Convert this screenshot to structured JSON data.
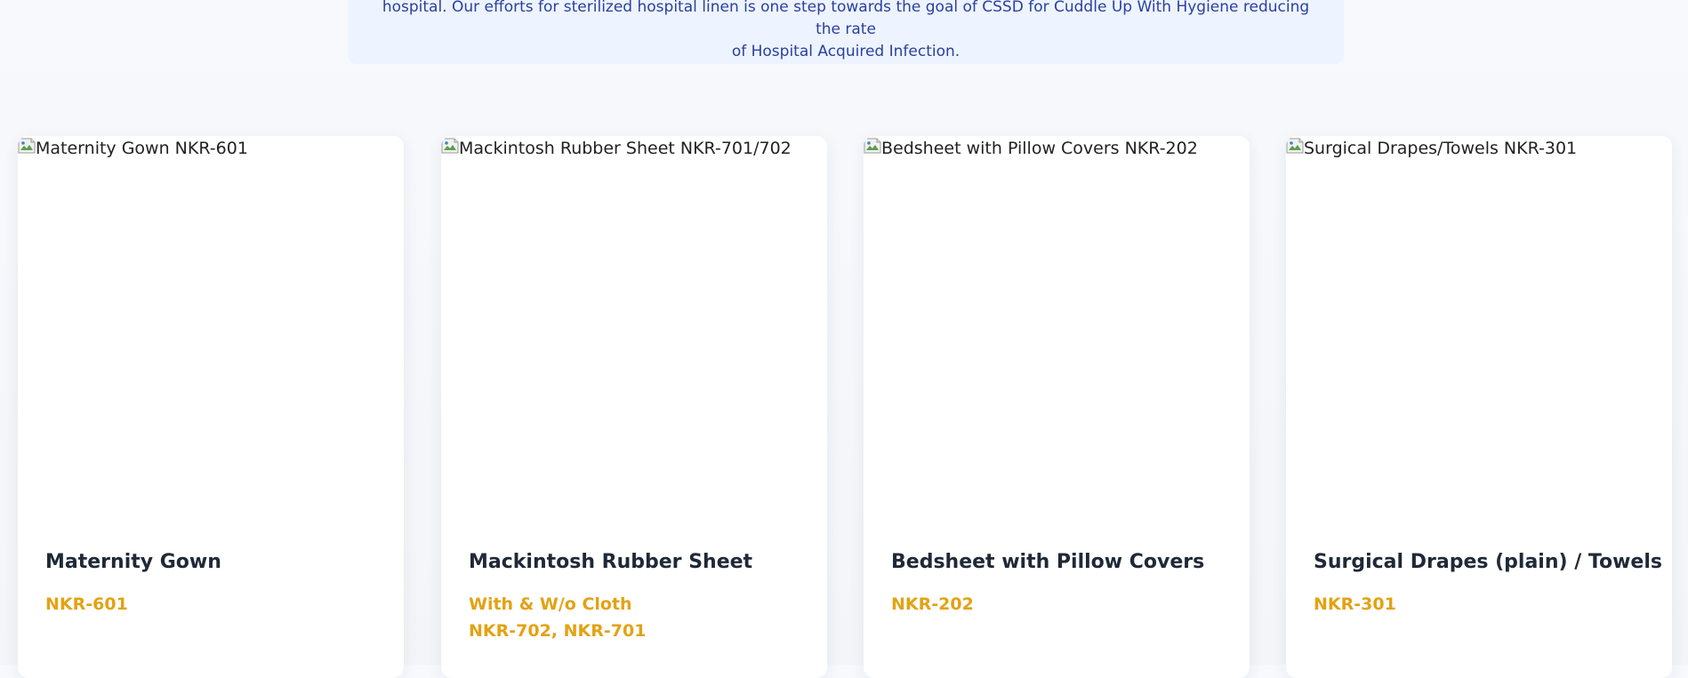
{
  "notice": {
    "line1": "hospital. Our efforts for sterilized hospital linen is one step towards the goal of CSSD for Cuddle Up With Hygiene reducing the rate",
    "line2": "of Hospital Acquired Infection."
  },
  "colors": {
    "notice_bg": "#edf4ff",
    "notice_text": "#2b3fa0",
    "title": "#1f2937",
    "code": "#e3a214"
  },
  "products": [
    {
      "image_alt": "Maternity Gown NKR-601",
      "title": "Maternity Gown",
      "code_lines": [
        "NKR-601"
      ]
    },
    {
      "image_alt": "Mackintosh Rubber Sheet NKR-701/702",
      "title": "Mackintosh Rubber Sheet",
      "code_lines": [
        "With & W/o Cloth",
        "NKR-702, NKR-701"
      ]
    },
    {
      "image_alt": "Bedsheet with Pillow Covers NKR-202",
      "title": "Bedsheet with Pillow Covers",
      "code_lines": [
        "NKR-202"
      ]
    },
    {
      "image_alt": "Surgical Drapes/Towels NKR-301",
      "title": "Surgical Drapes (plain) / Towels",
      "code_lines": [
        "NKR-301"
      ]
    }
  ]
}
